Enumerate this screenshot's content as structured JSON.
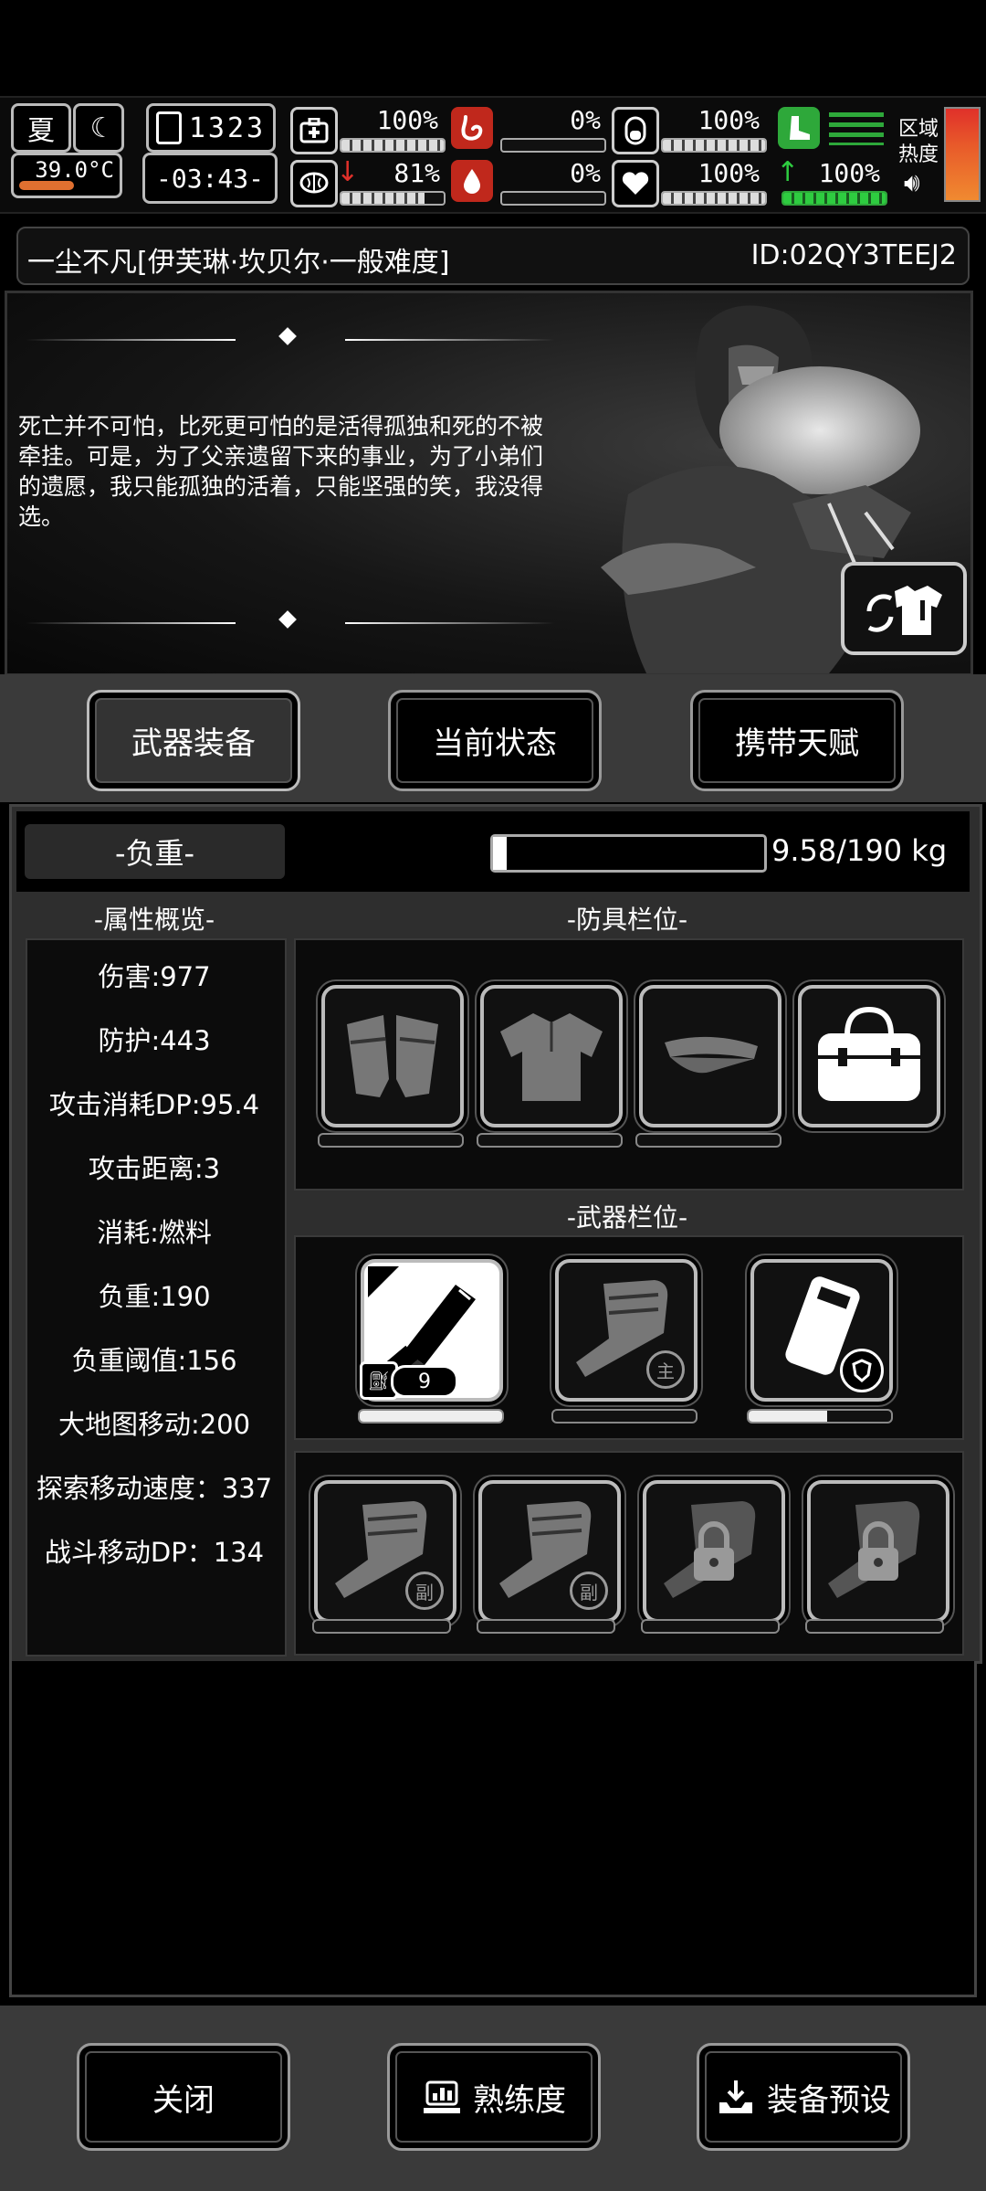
{
  "hud": {
    "season": "夏",
    "temperature": "39.0°C",
    "day": "1323",
    "time": "-03:43-",
    "region_label_line1": "区域",
    "region_label_line2": "热度",
    "stats": [
      {
        "icon": "medkit-icon",
        "value": "100%",
        "level": 1.0
      },
      {
        "icon": "stomach-icon",
        "value": "0%",
        "level": 0.0
      },
      {
        "icon": "stamina-icon",
        "value": "100%",
        "level": 1.0
      },
      {
        "icon": "brain-icon",
        "value": "81%",
        "level": 0.81
      },
      {
        "icon": "blood-drop-icon",
        "value": "0%",
        "level": 0.0
      },
      {
        "icon": "heart-icon",
        "value": "100%",
        "level": 1.0
      },
      {
        "icon": "boot-icon",
        "value": "100%",
        "level": 1.0
      }
    ]
  },
  "character": {
    "title": "一尘不凡[伊芙琳·坎贝尔·一般难度]",
    "id": "ID:02QY3TEEJ2",
    "story": "死亡并不可怕，比死更可怕的是活得孤独和死的不被牵挂。可是，为了父亲遗留下来的事业，为了小弟们的遗愿，我只能孤独的活着，只能坚强的笑，我没得选。"
  },
  "tabs": {
    "weapons": "武器装备",
    "status": "当前状态",
    "talents": "携带天赋"
  },
  "load": {
    "label": "-负重-",
    "value": "9.58/190 kg",
    "fraction": 0.05
  },
  "sections": {
    "attributes": "-属性概览-",
    "armor": "-防具栏位-",
    "weapons": "-武器栏位-"
  },
  "attributes": [
    "伤害:977",
    "防护:443",
    "攻击消耗DP:95.4",
    "攻击距离:3",
    "消耗:燃料",
    "负重:190",
    "负重阈值:156",
    "大地图移动:200",
    "探索移动速度：337",
    "战斗移动DP：134"
  ],
  "weapon_slots": {
    "chainsaw_count": "9",
    "main_badge": "主",
    "secondary_badge": "副",
    "chainsaw_durability": 1.0,
    "backpack_durability": 0.55
  },
  "buttons": {
    "close": "关闭",
    "proficiency": "熟练度",
    "preset": "装备预设"
  }
}
